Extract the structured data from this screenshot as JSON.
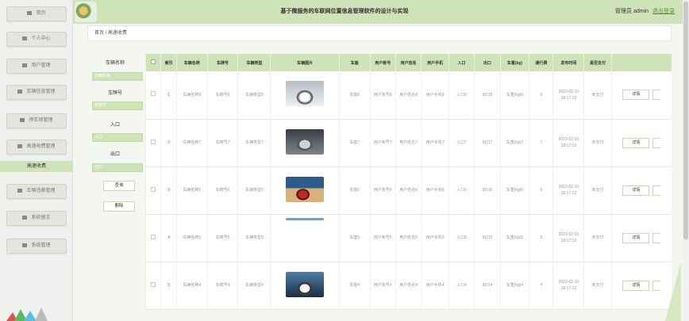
{
  "header": {
    "title": "基于微服务的车联网位置信息管理软件的设计与实现",
    "user": "管理员 admin",
    "logout": "退出登录"
  },
  "sidebar": {
    "items": [
      {
        "label": "首页",
        "icon": "home-icon"
      },
      {
        "label": "个人中心",
        "icon": "person-icon"
      },
      {
        "label": "用户管理",
        "icon": "grid-icon"
      },
      {
        "label": "车辆信息管理",
        "icon": "list-icon"
      },
      {
        "label": "停车场管理",
        "icon": "parking-icon"
      },
      {
        "label": "高速收费管理",
        "icon": "toll-icon"
      },
      {
        "label": "车辆违章管理",
        "icon": "violation-icon"
      },
      {
        "label": "系统留言",
        "icon": "message-icon"
      },
      {
        "label": "系统管理",
        "icon": "settings-icon"
      }
    ],
    "active_sub": "高速收费"
  },
  "breadcrumb": {
    "home": "首页",
    "sep": "/",
    "current": "高速收费"
  },
  "search": {
    "name_label": "车辆名称",
    "name_placeholder": "车辆名称",
    "plate_label": "车牌号",
    "plate_placeholder": "车牌号",
    "entry_label": "入口",
    "entry_placeholder": "入口",
    "exit_label": "出口",
    "exit_placeholder": "出口",
    "query_button": "查询",
    "delete_button": "删除"
  },
  "table": {
    "headers": [
      "索引",
      "车辆名称",
      "车牌号",
      "车辆类型",
      "车辆图片",
      "车座",
      "用户账号",
      "用户姓名",
      "用户手机",
      "入口",
      "出口",
      "车重(kg)",
      "通行费",
      "发布时间",
      "是否支付"
    ],
    "rows": [
      {
        "index": "1",
        "name": "车辆名称8",
        "plate": "车牌号8",
        "type": "车辆类型8",
        "seat": "车座8",
        "account": "用户账号8",
        "username": "用户姓名8",
        "phone": "用户手机8",
        "entry": "入口8",
        "exit": "出口8",
        "weight": "车重(kg)8",
        "fee": "8",
        "time": "2023-02-10 18:17:13",
        "paid": "未支付"
      },
      {
        "index": "2",
        "name": "车辆名称7",
        "plate": "车牌号7",
        "type": "车辆类型7",
        "seat": "车座7",
        "account": "用户账号7",
        "username": "用户姓名7",
        "phone": "用户手机7",
        "entry": "入口7",
        "exit": "出口7",
        "weight": "车重(kg)7",
        "fee": "7",
        "time": "2023-02-10 18:17:13",
        "paid": "未支付"
      },
      {
        "index": "3",
        "name": "车辆名称6",
        "plate": "车牌号6",
        "type": "车辆类型6",
        "seat": "车座6",
        "account": "用户账号6",
        "username": "用户姓名6",
        "phone": "用户手机6",
        "entry": "入口6",
        "exit": "出口6",
        "weight": "车重(kg)6",
        "fee": "6",
        "time": "2023-02-10 18:17:13",
        "paid": "未支付"
      },
      {
        "index": "4",
        "name": "车辆名称5",
        "plate": "车牌号5",
        "type": "车辆类型5",
        "seat": "车座5",
        "account": "用户账号5",
        "username": "用户姓名5",
        "phone": "用户手机5",
        "entry": "入口5",
        "exit": "出口5",
        "weight": "车重(kg)5",
        "fee": "5",
        "time": "2023-02-10 18:17:13",
        "paid": "未支付"
      },
      {
        "index": "5",
        "name": "车辆名称4",
        "plate": "车牌号4",
        "type": "车辆类型4",
        "seat": "车座4",
        "account": "用户账号4",
        "username": "用户姓名4",
        "phone": "用户手机4",
        "entry": "入口4",
        "exit": "出口4",
        "weight": "车重(kg)4",
        "fee": "4",
        "time": "2023-02-10 18:17:13",
        "paid": "未支付"
      }
    ],
    "detail_button": "详情"
  },
  "colors": {
    "accent": "#cfe3b8",
    "link": "#5a8f3a"
  }
}
